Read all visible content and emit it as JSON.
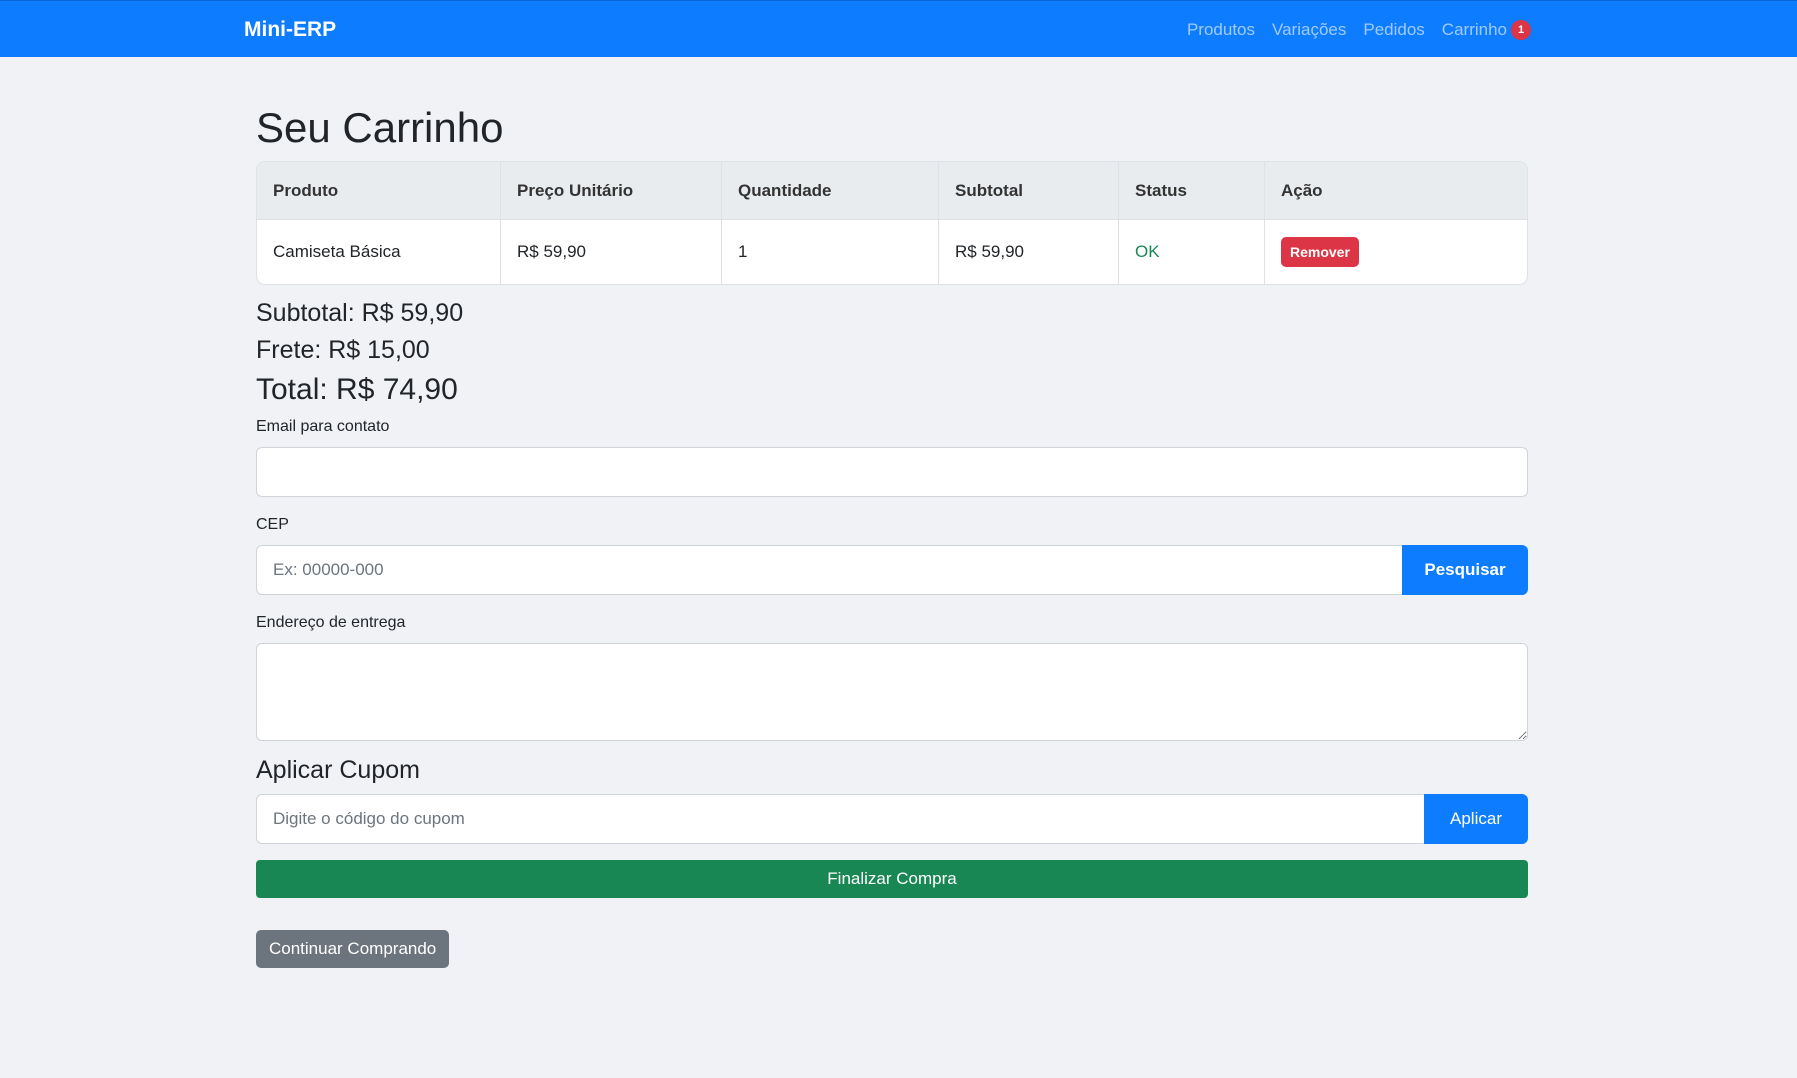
{
  "navbar": {
    "brand": "Mini-ERP",
    "links": [
      {
        "label": "Produtos"
      },
      {
        "label": "Variações"
      },
      {
        "label": "Pedidos"
      },
      {
        "label": "Carrinho",
        "badge": "1"
      }
    ]
  },
  "page": {
    "title": "Seu Carrinho"
  },
  "table": {
    "headers": [
      "Produto",
      "Preço Unitário",
      "Quantidade",
      "Subtotal",
      "Status",
      "Ação"
    ],
    "rows": [
      {
        "produto": "Camiseta Básica",
        "preco": "R$ 59,90",
        "quantidade": "1",
        "subtotal": "R$ 59,90",
        "status": "OK",
        "acao": "Remover"
      }
    ]
  },
  "summary": {
    "subtotal": "Subtotal: R$ 59,90",
    "frete": "Frete: R$ 15,00",
    "total": "Total: R$ 74,90"
  },
  "form": {
    "email_label": "Email para contato",
    "email_value": "",
    "cep_label": "CEP",
    "cep_placeholder": "Ex: 00000-000",
    "cep_button": "Pesquisar",
    "address_label": "Endereço de entrega",
    "address_value": ""
  },
  "coupon": {
    "title": "Aplicar Cupom",
    "placeholder": "Digite o código do cupom",
    "button": "Aplicar"
  },
  "actions": {
    "finalize": "Finalizar Compra",
    "continue": "Continuar Comprando"
  },
  "colors": {
    "navbar": "#0d7cff",
    "danger": "#dc3545",
    "success": "#198754",
    "secondary": "#6c757d"
  }
}
